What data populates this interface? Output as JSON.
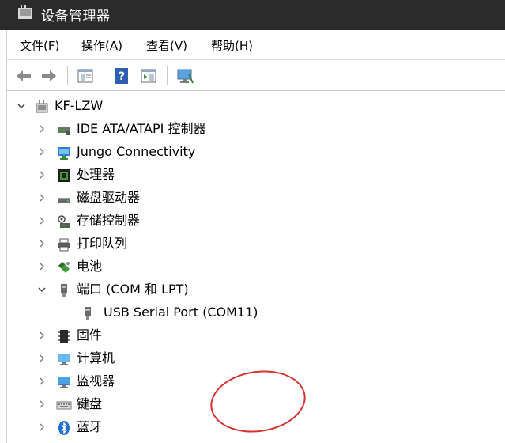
{
  "window": {
    "title": "设备管理器"
  },
  "menu": [
    {
      "label": "文件(",
      "acc": "F",
      "tail": ")"
    },
    {
      "label": "操作(",
      "acc": "A",
      "tail": ")"
    },
    {
      "label": "查看(",
      "acc": "V",
      "tail": ")"
    },
    {
      "label": "帮助(",
      "acc": "H",
      "tail": ")"
    }
  ],
  "toolbar": {
    "buttons": [
      "back-arrow-icon",
      "forward-arrow-icon",
      "properties-icon",
      "help-icon",
      "show-hide-console-tree-icon",
      "monitor-icon"
    ]
  },
  "tree": {
    "root": "KF-LZW",
    "items": [
      "IDE ATA/ATAPI 控制器",
      "Jungo Connectivity",
      "处理器",
      "磁盘驱动器",
      "存储控制器",
      "打印队列",
      "电池",
      "端口 (COM 和 LPT)",
      "USB Serial Port (COM11)",
      "固件",
      "计算机",
      "监视器",
      "键盘",
      "蓝牙"
    ]
  },
  "colors": {
    "titlebar": "#2b2b2b",
    "annotation": "#d6332e"
  }
}
